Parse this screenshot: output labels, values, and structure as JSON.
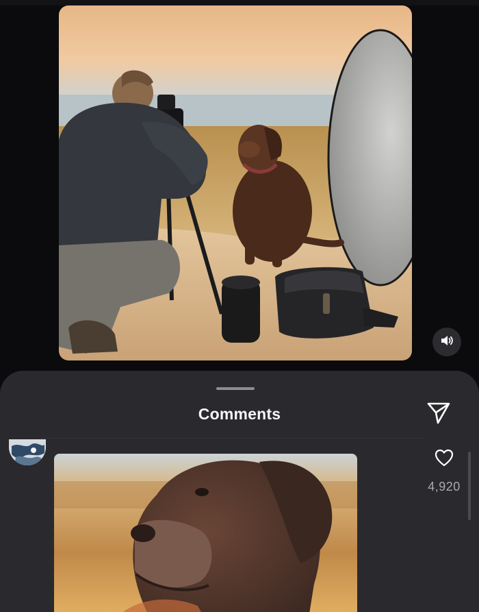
{
  "comments_sheet": {
    "title": "Comments",
    "comment": {
      "like_count": "4,920"
    }
  },
  "icons": {
    "sound": "speaker-volume-icon",
    "share": "paper-plane-icon",
    "like": "heart-outline-icon"
  },
  "colors": {
    "background": "#0b0b0d",
    "sheet": "#2a2a2e",
    "text": "#f2f2f4",
    "muted_text": "#a9a9ae"
  }
}
